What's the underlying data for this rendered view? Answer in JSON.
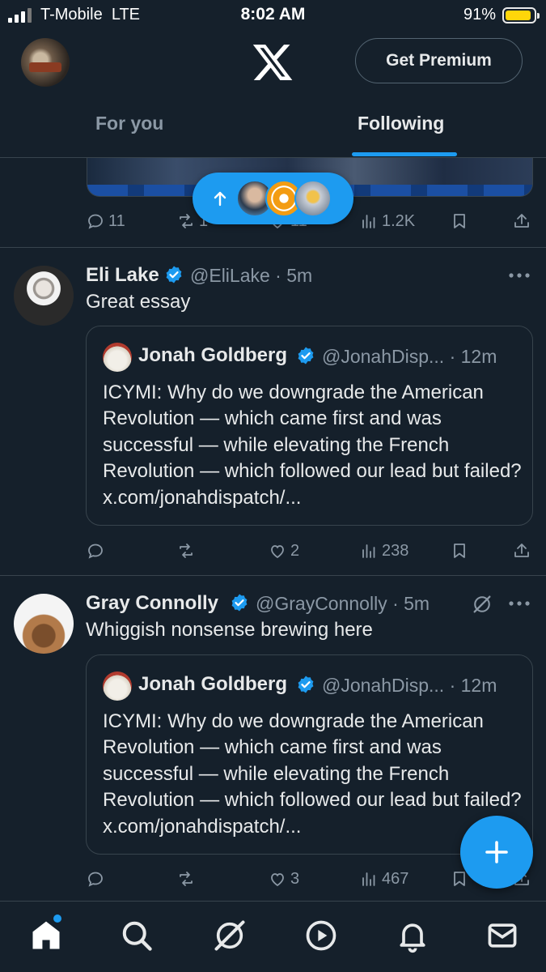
{
  "status_bar": {
    "carrier": "T-Mobile",
    "network": "LTE",
    "time": "8:02 AM",
    "battery": "91%"
  },
  "header": {
    "premium_label": "Get Premium",
    "tabs": [
      {
        "label": "For you",
        "active": false
      },
      {
        "label": "Following",
        "active": true
      }
    ]
  },
  "top_post_actions": {
    "replies": "11",
    "reposts": "1",
    "likes": "11",
    "views": "1.2K"
  },
  "posts": [
    {
      "name": "Eli Lake",
      "handle_time": "@EliLake · 5m",
      "text": "Great essay",
      "quote": {
        "name": "Jonah Goldberg",
        "handle_time": "@JonahDisp... · 12m",
        "text": "ICYMI: Why do we downgrade the American Revolution — which came first and was successful — while elevating the French Revolution — which followed our lead but failed? x.com/jonahdispatch/..."
      },
      "actions": {
        "replies": "",
        "reposts": "",
        "likes": "2",
        "views": "238"
      }
    },
    {
      "name": "Gray Connolly",
      "handle_time": "@GrayConnolly · 5m",
      "text": "Whiggish nonsense brewing here",
      "quote": {
        "name": "Jonah Goldberg",
        "handle_time": "@JonahDisp... · 12m",
        "text": "ICYMI: Why do we downgrade the American Revolution — which came first and was successful — while elevating the French Revolution — which followed our lead but failed? x.com/jonahdispatch/..."
      },
      "actions": {
        "replies": "",
        "reposts": "",
        "likes": "3",
        "views": "467"
      }
    }
  ],
  "colors": {
    "background": "#15202b",
    "accent": "#1d9bf0",
    "divider": "#38444d",
    "muted_text": "#8b98a5"
  },
  "icons": [
    "x-logo",
    "verified-badge",
    "grok-icon",
    "more-icon",
    "reply-icon",
    "repost-icon",
    "like-icon",
    "views-icon",
    "bookmark-icon",
    "share-icon",
    "compose-icon",
    "home-icon",
    "search-icon",
    "play-icon",
    "bell-icon",
    "mail-icon"
  ]
}
